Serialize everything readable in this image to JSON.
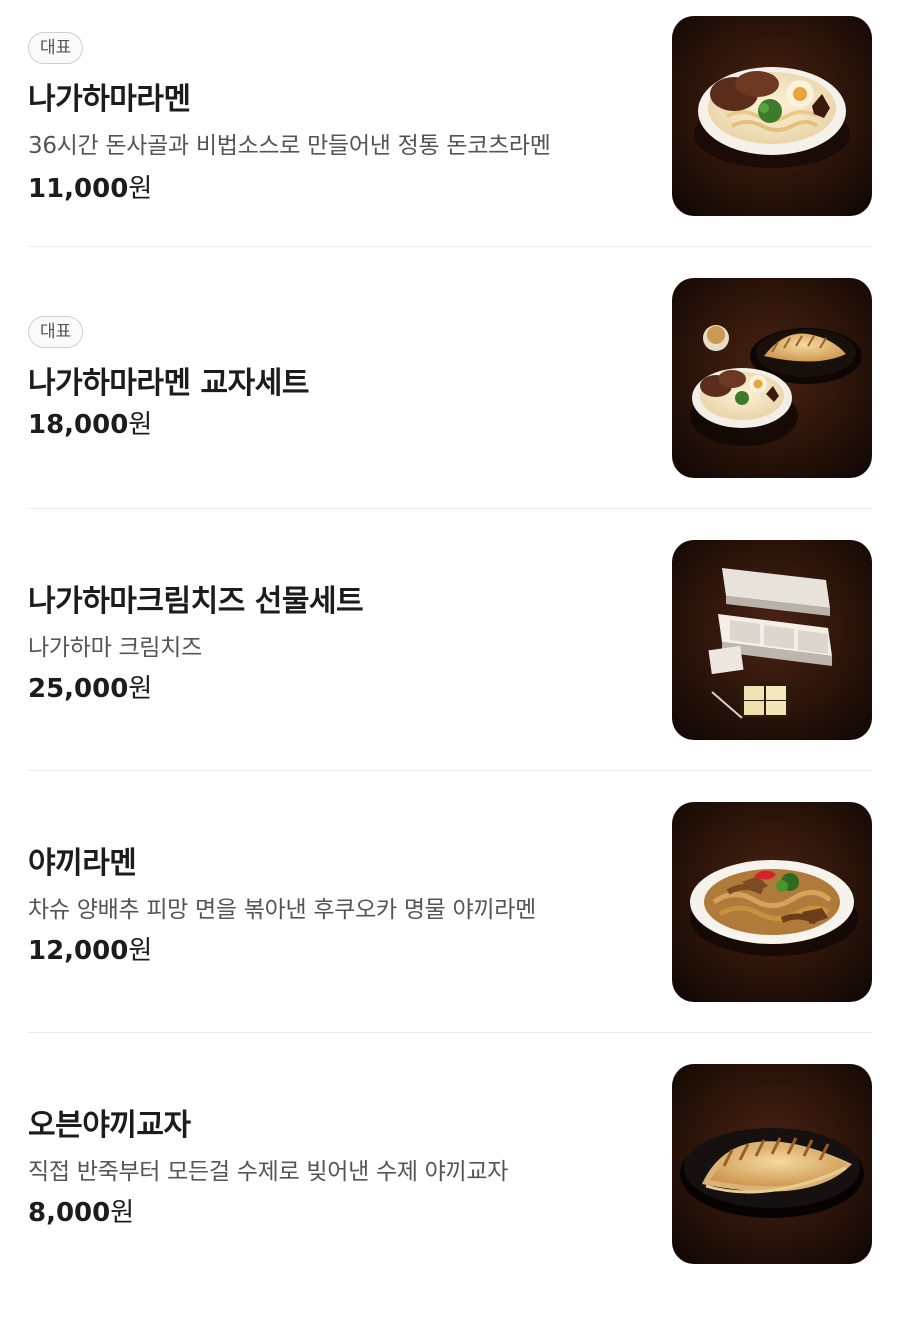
{
  "menu": {
    "items": [
      {
        "badge": "대표",
        "name": "나가하마라멘",
        "description": "36시간 돈사골과 비법소스로 만들어낸 정통 돈코츠라멘",
        "price": "11,000",
        "currency": "원",
        "image": "tonkotsu-ramen-photo"
      },
      {
        "badge": "대표",
        "name": "나가하마라멘 교자세트",
        "price": "18,000",
        "currency": "원",
        "image": "ramen-gyoza-set-photo"
      },
      {
        "name": "나가하마크림치즈 선물세트",
        "description": "나가하마 크림치즈",
        "price": "25,000",
        "currency": "원",
        "image": "cream-cheese-gift-box-photo"
      },
      {
        "name": "야끼라멘",
        "description": "차슈 양배추 피망 면을 볶아낸 후쿠오카 명물 야끼라멘",
        "price": "12,000",
        "currency": "원",
        "image": "yaki-ramen-photo"
      },
      {
        "name": "오븐야끼교자",
        "description": "직접 반죽부터 모든걸 수제로 빚어낸 수제 야끼교자",
        "price": "8,000",
        "currency": "원",
        "image": "yaki-gyoza-photo"
      }
    ]
  }
}
